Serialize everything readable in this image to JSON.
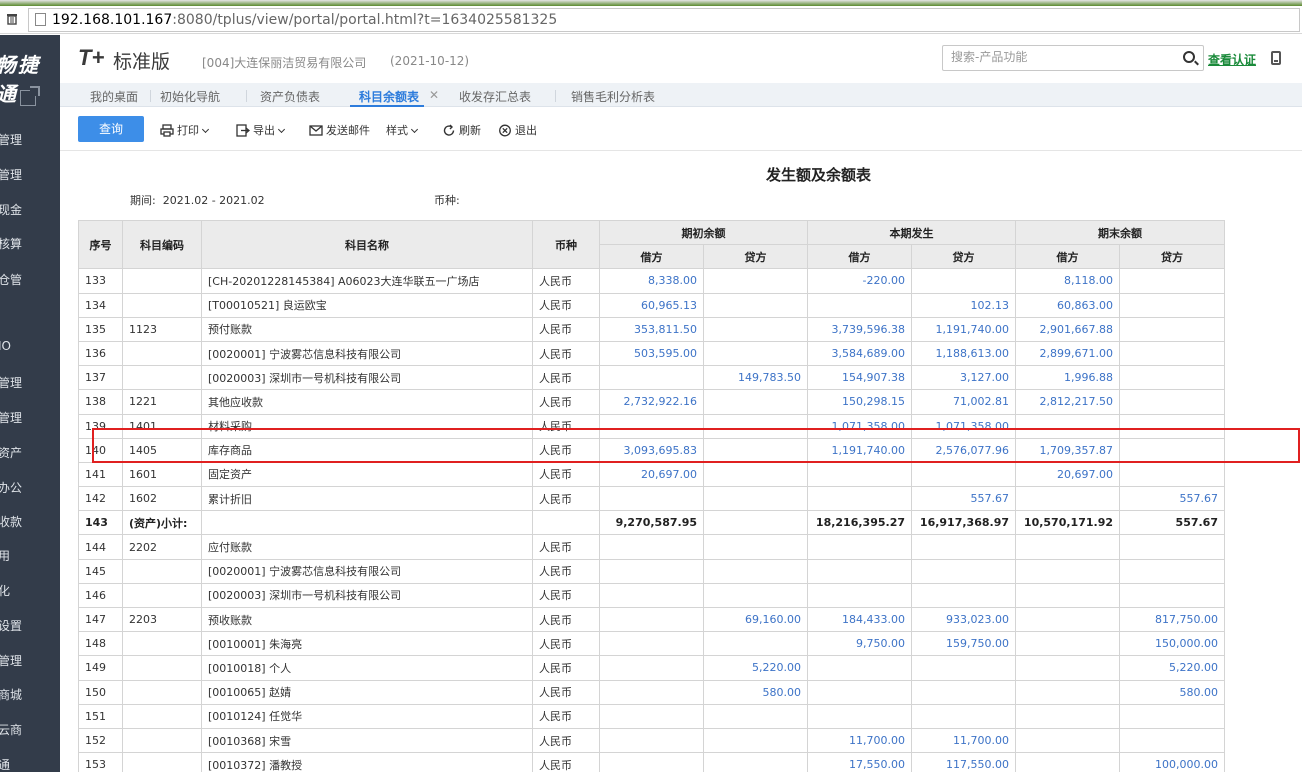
{
  "browser": {
    "url_main": "192.168.101.167",
    "url_rest": ":8080/tplus/view/portal/portal.html?t=1634025581325"
  },
  "sidebar": {
    "brand": "畅捷通",
    "items": [
      "管理",
      "管理",
      "现金",
      "核算",
      "仓管",
      "IO",
      "管理",
      "管理",
      "资产",
      "办公",
      "收款",
      "用",
      "化",
      "设置",
      "管理",
      "商城",
      "云商",
      "通"
    ]
  },
  "header": {
    "logo": "T+",
    "edition": "标准版",
    "company": "[004]大连保丽洁贸易有限公司",
    "date": "(2021-10-12)",
    "search_placeholder": "搜索-产品功能",
    "cert_link": "查看认证"
  },
  "tabs": [
    {
      "label": "我的桌面"
    },
    {
      "label": "初始化导航"
    },
    {
      "label": "资产负债表"
    },
    {
      "label": "科目余额表",
      "active": true
    },
    {
      "label": "收发存汇总表"
    },
    {
      "label": "销售毛利分析表"
    }
  ],
  "toolbar": {
    "query": "查询",
    "print": "打印",
    "export": "导出",
    "send_mail": "发送邮件",
    "style": "样式",
    "refresh": "刷新",
    "exit": "退出"
  },
  "report": {
    "title": "发生额及余额表",
    "period_label": "期间:",
    "period_value": "2021.02 - 2021.02",
    "currency_label": "币种:",
    "headers": {
      "seq": "序号",
      "code": "科目编码",
      "name": "科目名称",
      "currency": "币种",
      "opening": "期初余额",
      "current": "本期发生",
      "closing": "期末余额",
      "debit": "借方",
      "credit": "贷方"
    },
    "rows": [
      {
        "seq": "133",
        "code": "",
        "name": "[CH-20201228145384] A06023大连华联五一广场店",
        "cur": "人民币",
        "od": "8,338.00",
        "oc": "",
        "cd": "-220.00",
        "cc": "",
        "ed": "8,118.00",
        "ec": ""
      },
      {
        "seq": "134",
        "code": "",
        "name": "[T00010521] 良运欧宝",
        "cur": "人民币",
        "od": "60,965.13",
        "oc": "",
        "cd": "",
        "cc": "102.13",
        "ed": "60,863.00",
        "ec": ""
      },
      {
        "seq": "135",
        "code": "1123",
        "name": "预付账款",
        "cur": "人民币",
        "od": "353,811.50",
        "oc": "",
        "cd": "3,739,596.38",
        "cc": "1,191,740.00",
        "ed": "2,901,667.88",
        "ec": ""
      },
      {
        "seq": "136",
        "code": "",
        "name": "[0020001] 宁波雾芯信息科技有限公司",
        "cur": "人民币",
        "od": "503,595.00",
        "oc": "",
        "cd": "3,584,689.00",
        "cc": "1,188,613.00",
        "ed": "2,899,671.00",
        "ec": ""
      },
      {
        "seq": "137",
        "code": "",
        "name": "[0020003] 深圳市一号机科技有限公司",
        "cur": "人民币",
        "od": "",
        "oc": "149,783.50",
        "cd": "154,907.38",
        "cc": "3,127.00",
        "ed": "1,996.88",
        "ec": ""
      },
      {
        "seq": "138",
        "code": "1221",
        "name": "其他应收款",
        "cur": "人民币",
        "od": "2,732,922.16",
        "oc": "",
        "cd": "150,298.15",
        "cc": "71,002.81",
        "ed": "2,812,217.50",
        "ec": ""
      },
      {
        "seq": "139",
        "code": "1401",
        "name": "材料采购",
        "cur": "人民币",
        "od": "",
        "oc": "",
        "cd": "1,071,358.00",
        "cc": "1,071,358.00",
        "ed": "",
        "ec": ""
      },
      {
        "seq": "140",
        "code": "1405",
        "name": "库存商品",
        "cur": "人民币",
        "od": "3,093,695.83",
        "oc": "",
        "cd": "1,191,740.00",
        "cc": "2,576,077.96",
        "ed": "1,709,357.87",
        "ec": ""
      },
      {
        "seq": "141",
        "code": "1601",
        "name": "固定资产",
        "cur": "人民币",
        "od": "20,697.00",
        "oc": "",
        "cd": "",
        "cc": "",
        "ed": "20,697.00",
        "ec": ""
      },
      {
        "seq": "142",
        "code": "1602",
        "name": "累计折旧",
        "cur": "人民币",
        "od": "",
        "oc": "",
        "cd": "",
        "cc": "557.67",
        "ed": "",
        "ec": "557.67"
      },
      {
        "seq": "143",
        "code": "(资产)小计:",
        "name": "",
        "cur": "",
        "od": "9,270,587.95",
        "oc": "",
        "cd": "18,216,395.27",
        "cc": "16,917,368.97",
        "ed": "10,570,171.92",
        "ec": "557.67",
        "subtotal": true
      },
      {
        "seq": "144",
        "code": "2202",
        "name": "应付账款",
        "cur": "人民币",
        "od": "",
        "oc": "",
        "cd": "",
        "cc": "",
        "ed": "",
        "ec": ""
      },
      {
        "seq": "145",
        "code": "",
        "name": "[0020001] 宁波雾芯信息科技有限公司",
        "cur": "人民币",
        "od": "",
        "oc": "",
        "cd": "",
        "cc": "",
        "ed": "",
        "ec": ""
      },
      {
        "seq": "146",
        "code": "",
        "name": "[0020003] 深圳市一号机科技有限公司",
        "cur": "人民币",
        "od": "",
        "oc": "",
        "cd": "",
        "cc": "",
        "ed": "",
        "ec": ""
      },
      {
        "seq": "147",
        "code": "2203",
        "name": "预收账款",
        "cur": "人民币",
        "od": "",
        "oc": "69,160.00",
        "cd": "184,433.00",
        "cc": "933,023.00",
        "ed": "",
        "ec": "817,750.00"
      },
      {
        "seq": "148",
        "code": "",
        "name": "[0010001] 朱海亮",
        "cur": "人民币",
        "od": "",
        "oc": "",
        "cd": "9,750.00",
        "cc": "159,750.00",
        "ed": "",
        "ec": "150,000.00"
      },
      {
        "seq": "149",
        "code": "",
        "name": "[0010018] 个人",
        "cur": "人民币",
        "od": "",
        "oc": "5,220.00",
        "cd": "",
        "cc": "",
        "ed": "",
        "ec": "5,220.00"
      },
      {
        "seq": "150",
        "code": "",
        "name": "[0010065] 赵婧",
        "cur": "人民币",
        "od": "",
        "oc": "580.00",
        "cd": "",
        "cc": "",
        "ed": "",
        "ec": "580.00"
      },
      {
        "seq": "151",
        "code": "",
        "name": "[0010124] 任觉华",
        "cur": "人民币",
        "od": "",
        "oc": "",
        "cd": "",
        "cc": "",
        "ed": "",
        "ec": ""
      },
      {
        "seq": "152",
        "code": "",
        "name": "[0010368] 宋雪",
        "cur": "人民币",
        "od": "",
        "oc": "",
        "cd": "11,700.00",
        "cc": "11,700.00",
        "ed": "",
        "ec": ""
      },
      {
        "seq": "153",
        "code": "",
        "name": "[0010372] 潘教授",
        "cur": "人民币",
        "od": "",
        "oc": "",
        "cd": "17,550.00",
        "cc": "117,550.00",
        "ed": "",
        "ec": "100,000.00"
      }
    ]
  },
  "colors": {
    "sidebar_bg": "#333c4a",
    "accent": "#3d8ee8",
    "number_blue": "#3d73c7",
    "highlight_red": "#e02020",
    "cert_green": "#1a8a3a"
  }
}
